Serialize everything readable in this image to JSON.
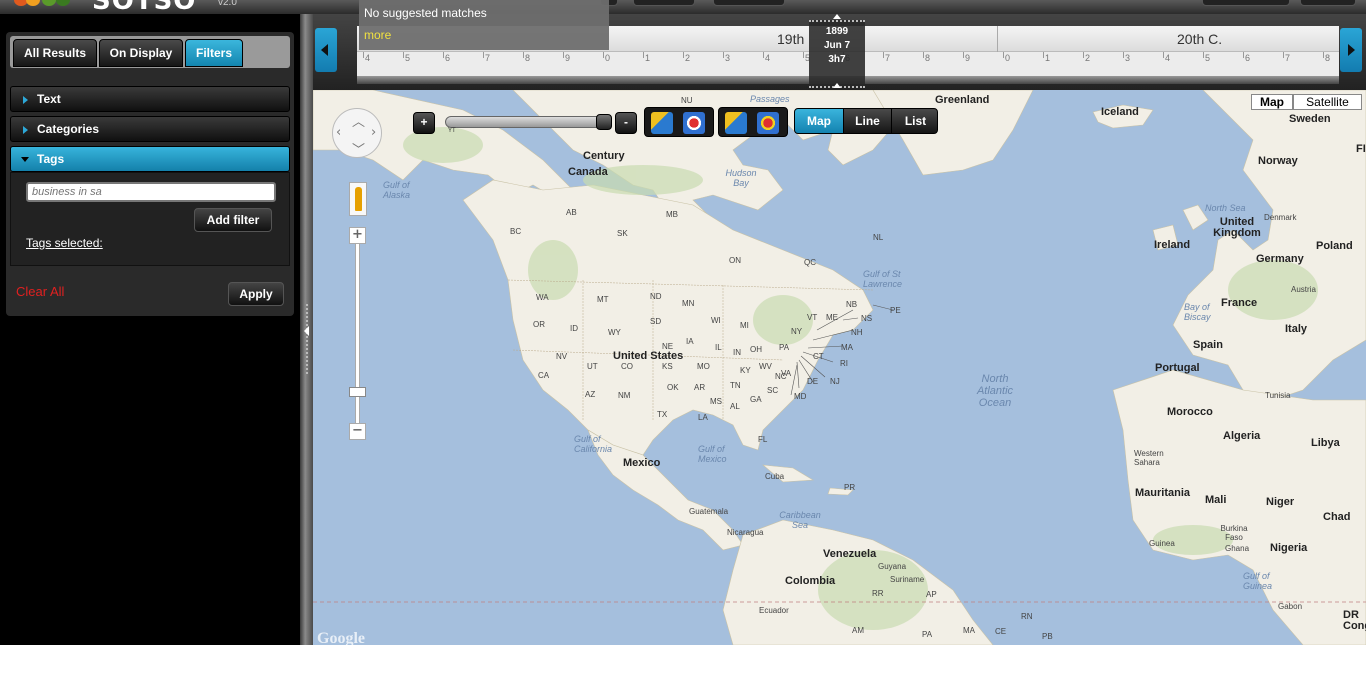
{
  "app": {
    "logo_text": "SOTSO",
    "version": "v2.0"
  },
  "search_suggest": {
    "message": "No suggested matches",
    "more_label": "more"
  },
  "sidebar": {
    "tabs": [
      {
        "label": "All Results",
        "active": false
      },
      {
        "label": "On Display",
        "active": false
      },
      {
        "label": "Filters",
        "active": true
      }
    ],
    "sections": [
      {
        "label": "Text",
        "open": false
      },
      {
        "label": "Categories",
        "open": false
      },
      {
        "label": "Tags",
        "open": true
      }
    ],
    "tag_input": {
      "value": "",
      "placeholder": "business in sa"
    },
    "add_filter_label": "Add filter",
    "tags_selected_label": "Tags selected:",
    "clear_all_label": "Clear All",
    "apply_label": "Apply"
  },
  "timeline": {
    "century_left": "19th",
    "century_right": "20th C.",
    "marker": {
      "year": "1899",
      "date": "Jun 7",
      "time": "3h7"
    },
    "ticks": [
      "4",
      "5",
      "6",
      "7",
      "8",
      "9",
      "0",
      "1",
      "2",
      "3",
      "4",
      "5",
      "6",
      "7",
      "8",
      "9",
      "0",
      "1",
      "2",
      "3",
      "4",
      "5",
      "6",
      "7",
      "8"
    ]
  },
  "map_controls": {
    "zoom_in": "+",
    "zoom_out": "-",
    "slider_label": "YT",
    "view_modes": [
      {
        "label": "Map",
        "active": true
      },
      {
        "label": "Line",
        "active": false
      },
      {
        "label": "List",
        "active": false
      }
    ],
    "map_types": [
      {
        "label": "Map",
        "active": true
      },
      {
        "label": "Satellite",
        "active": false
      }
    ],
    "google_watermark": "Google"
  },
  "map_labels": {
    "countries": [
      "Greenland",
      "Iceland",
      "Sweden",
      "Norway",
      "United Kingdom",
      "Ireland",
      "Denmark",
      "Poland",
      "Germany",
      "France",
      "Austria",
      "Italy",
      "Spain",
      "Portugal",
      "Morocco",
      "Algeria",
      "Libya",
      "Tunisia",
      "Western Sahara",
      "Mauritania",
      "Mali",
      "Niger",
      "Chad",
      "Burkina Faso",
      "Ghana",
      "Nigeria",
      "Guinea",
      "Gabon",
      "Canada",
      "United States",
      "Mexico",
      "Cuba",
      "Guatemala",
      "Nicaragua",
      "Venezuela",
      "Guyana",
      "Suriname",
      "Colombia",
      "Ecuador",
      "Century"
    ],
    "states": [
      "NU",
      "AB",
      "MB",
      "ON",
      "QC",
      "NL",
      "BC",
      "SK",
      "WA",
      "MT",
      "ND",
      "MN",
      "OR",
      "ID",
      "WY",
      "SD",
      "NV",
      "UT",
      "CO",
      "KS",
      "NE",
      "MO",
      "CA",
      "AZ",
      "NM",
      "OK",
      "AR",
      "TX",
      "LA",
      "MS",
      "AL",
      "GA",
      "SC",
      "NC",
      "TN",
      "KY",
      "WV",
      "VA",
      "VT",
      "ME",
      "NH",
      "MA",
      "RI",
      "CT",
      "NJ",
      "DE",
      "MD",
      "NY",
      "PA",
      "OH",
      "IN",
      "IL",
      "WI",
      "MI",
      "IA",
      "FL",
      "NB",
      "NS",
      "PE",
      "PR",
      "RR",
      "AP",
      "AM",
      "PA",
      "MA",
      "CE",
      "RN",
      "PB",
      "FI",
      "DR Cong"
    ],
    "seas": [
      "Gulf of Alaska",
      "Hudson Bay",
      "Gulf of St Lawrence",
      "Gulf of California",
      "Gulf of Mexico",
      "Caribbean Sea",
      "North Sea",
      "Bay of Biscay",
      "Gulf of Guinea",
      "Passages"
    ],
    "ocean": "North Atlantic Ocean"
  }
}
